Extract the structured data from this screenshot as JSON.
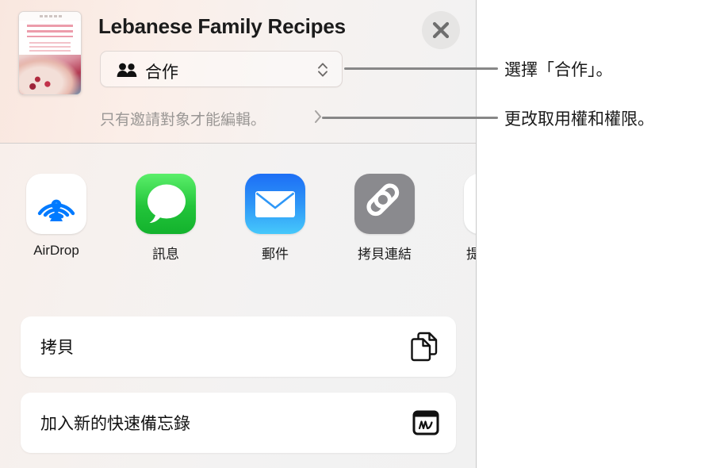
{
  "share_sheet": {
    "document": {
      "title": "Lebanese Family Recipes",
      "thumbnail_name": "document-thumbnail"
    },
    "close_label": "×",
    "permission_popup": {
      "value": "合作",
      "icon": "two-people-icon",
      "chevron": "up-down-chevron-icon"
    },
    "permission_subtitle": {
      "text": "只有邀請對象才能編輯。",
      "chevron": "chevron-right-icon"
    },
    "apps": [
      {
        "name": "AirDrop",
        "icon": "airdrop-icon",
        "color": "#007aff"
      },
      {
        "name": "訊息",
        "icon": "messages-icon",
        "color": "#22c43a"
      },
      {
        "name": "郵件",
        "icon": "mail-icon",
        "color": "#2e97f7"
      },
      {
        "name": "拷貝連結",
        "icon": "copy-link-icon",
        "color": "#8a8a8e"
      },
      {
        "name": "提",
        "icon": "reminders-icon",
        "color": "#ffffff"
      }
    ],
    "actions": [
      {
        "label": "拷貝",
        "icon": "copy-documents-icon"
      },
      {
        "label": "加入新的快速備忘錄",
        "icon": "quick-note-icon"
      }
    ]
  },
  "callouts": [
    {
      "text": "選擇「合作」。"
    },
    {
      "text": "更改取用權和權限。"
    }
  ],
  "colors": {
    "panel_background": "#f2f2f2",
    "header_pink": "#f9e7df",
    "leader_line": "#878787",
    "subtitle_gray": "#9a9795"
  }
}
